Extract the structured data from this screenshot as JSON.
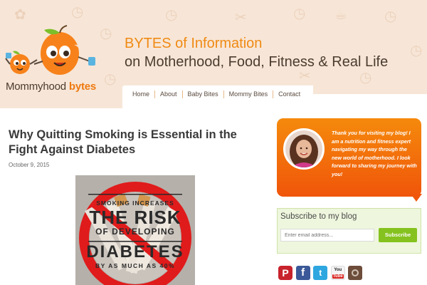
{
  "site": {
    "logo_text_prefix": "Mommyhood ",
    "logo_text_bytes": "bytes",
    "tagline_line1_prefix": "BYTES",
    "tagline_line1_rest": " of Information",
    "tagline_line2": "on Motherhood, Food, Fitness & Real Life"
  },
  "nav": {
    "items": [
      "Home",
      "About",
      "Baby Bites",
      "Mommy Bites",
      "Contact"
    ]
  },
  "post": {
    "title": "Why Quitting Smoking is Essential in the Fight Against Diabetes",
    "date": "October 9, 2015",
    "image": {
      "line1": "SMOKING INCREASES",
      "line2": "THE RISK",
      "line3": "OF DEVELOPING",
      "line4": "DIABETES",
      "line5": "BY AS MUCH AS 40%"
    }
  },
  "sidebar": {
    "welcome_text": "Thank you for visiting my blog! I am a nutrition and fitness expert navigating my way through the new world of motherhood. I look forward to sharing my journey with you!",
    "subscribe_title": "Subscribe to my blog",
    "email_placeholder": "Enter email address...",
    "subscribe_button": "Subscribe",
    "social_icons": [
      "pinterest-icon",
      "facebook-icon",
      "twitter-icon",
      "youtube-icon",
      "instagram-icon"
    ]
  },
  "colors": {
    "accent_orange": "#f08a14",
    "header_bg": "#f7e6d7",
    "subscribe_green": "#85c21f"
  }
}
